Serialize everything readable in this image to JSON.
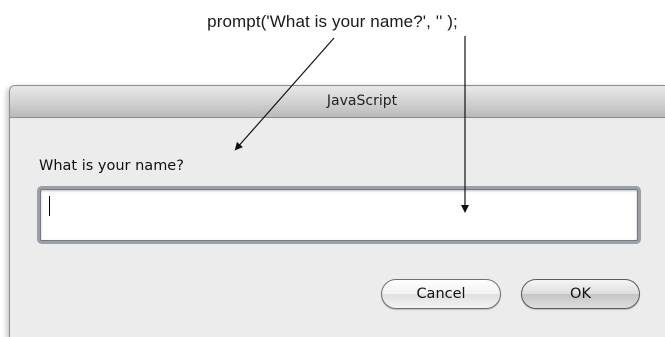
{
  "caption": {
    "code": "prompt('What is your name?', '' );"
  },
  "dialog": {
    "title": "JavaScript",
    "prompt_label": "What is your name?",
    "input_value": "",
    "buttons": {
      "cancel": "Cancel",
      "ok": "OK"
    }
  }
}
